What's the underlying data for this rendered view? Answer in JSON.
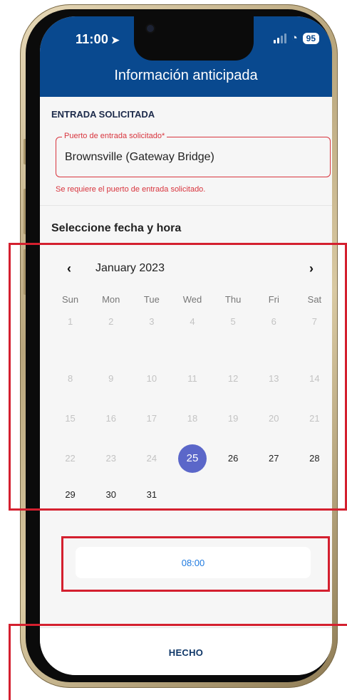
{
  "status_bar": {
    "time": "11:00",
    "battery": "95"
  },
  "header": {
    "title": "Información anticipada"
  },
  "entry": {
    "section_label": "ENTRADA SOLICITADA",
    "port_label": "Puerto de entrada solicitado*",
    "port_value": "Brownsville (Gateway Bridge)",
    "port_error": "Se requiere el puerto de entrada solicitado."
  },
  "schedule": {
    "label": "Seleccione fecha y hora",
    "month": "January 2023",
    "weekdays": [
      "Sun",
      "Mon",
      "Tue",
      "Wed",
      "Thu",
      "Fri",
      "Sat"
    ],
    "days": [
      [
        "1",
        "2",
        "3",
        "4",
        "5",
        "6",
        "7"
      ],
      [
        "8",
        "9",
        "10",
        "11",
        "12",
        "13",
        "14"
      ],
      [
        "15",
        "16",
        "17",
        "18",
        "19",
        "20",
        "21"
      ],
      [
        "22",
        "23",
        "24",
        "25",
        "26",
        "27",
        "28"
      ],
      [
        "29",
        "30",
        "31",
        "",
        "",
        "",
        ""
      ]
    ],
    "selected_day": "25",
    "time": "08:00"
  },
  "footer": {
    "done_label": "HECHO"
  },
  "colors": {
    "header_blue": "#09498f",
    "selected_day": "#5b67c9",
    "error_red": "#d8353e",
    "annotation_red": "#d4202f",
    "time_blue": "#1f7ae0"
  }
}
